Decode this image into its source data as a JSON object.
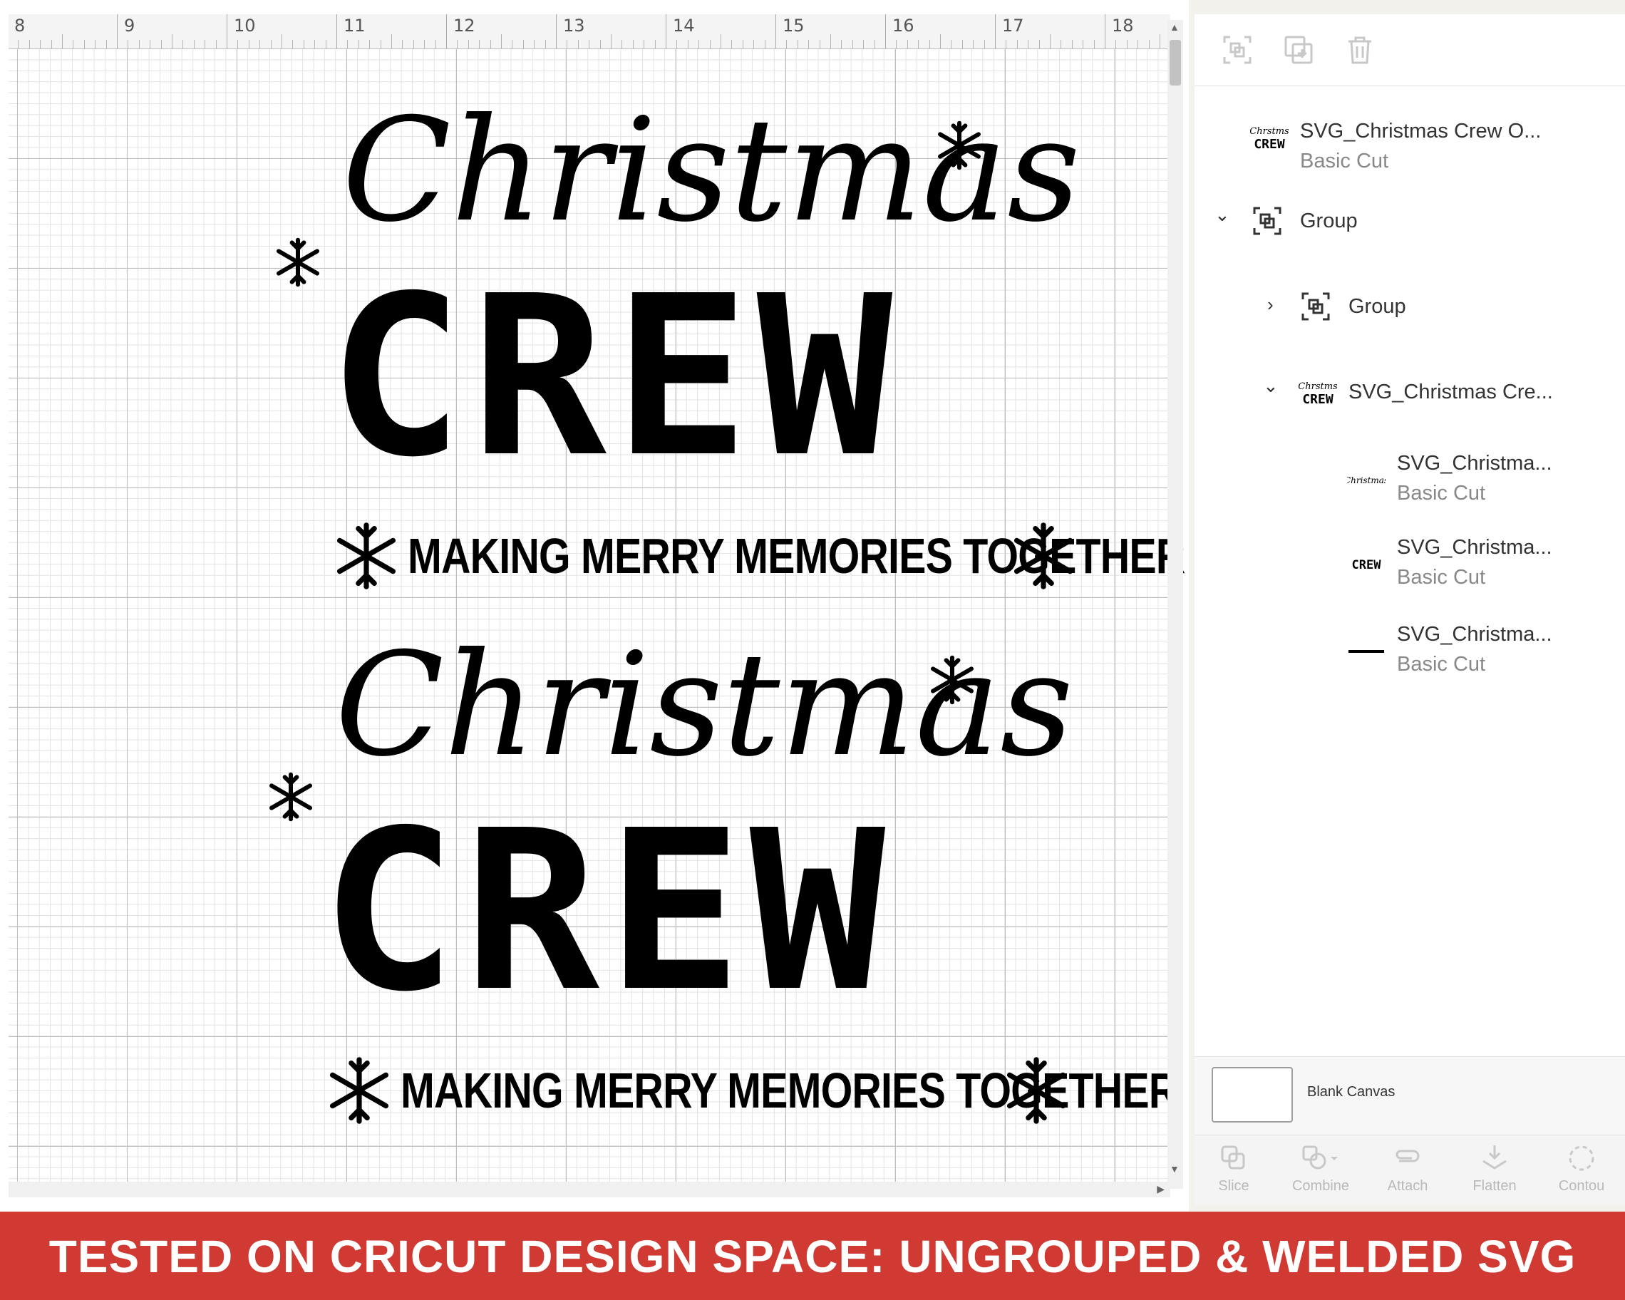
{
  "ruler": {
    "labels": [
      "8",
      "9",
      "10",
      "11",
      "12",
      "13",
      "14",
      "15",
      "16",
      "17",
      "18"
    ]
  },
  "designs": [
    {
      "script_text": "Christmas",
      "title_text": "CREW",
      "tagline": "MAKING MERRY MEMORIES TOGETHER"
    },
    {
      "script_text": "Christmas",
      "title_text": "CREW",
      "tagline": "MAKING MERRY MEMORIES TOGETHER"
    }
  ],
  "layers_panel": {
    "toolbar_icons": [
      "group-icon",
      "duplicate-icon",
      "delete-icon"
    ],
    "layers": [
      {
        "name": "SVG_Christmas Crew O...",
        "sub": "Basic Cut",
        "icon": "christmas-crew-thumbnail"
      },
      {
        "name": "Group",
        "icon": "group-icon",
        "expanded": true
      },
      {
        "name": "Group",
        "icon": "group-icon",
        "expanded": false
      },
      {
        "name": "SVG_Christmas Cre...",
        "icon": "christmas-crew-thumbnail",
        "expanded": true
      },
      {
        "name": "SVG_Christma...",
        "sub": "Basic Cut",
        "icon": "christmas-script-thumbnail"
      },
      {
        "name": "SVG_Christma...",
        "sub": "Basic Cut",
        "icon": "crew-thumbnail"
      },
      {
        "name": "SVG_Christma...",
        "sub": "Basic Cut",
        "icon": "line-thumbnail"
      }
    ],
    "blank_canvas_label": "Blank Canvas",
    "tools": [
      "Slice",
      "Combine",
      "Attach",
      "Flatten",
      "Contou"
    ]
  },
  "banner": {
    "text": "TESTED ON CRICUT DESIGN SPACE: UNGROUPED & WELDED SVG",
    "color": "#d03a32"
  }
}
